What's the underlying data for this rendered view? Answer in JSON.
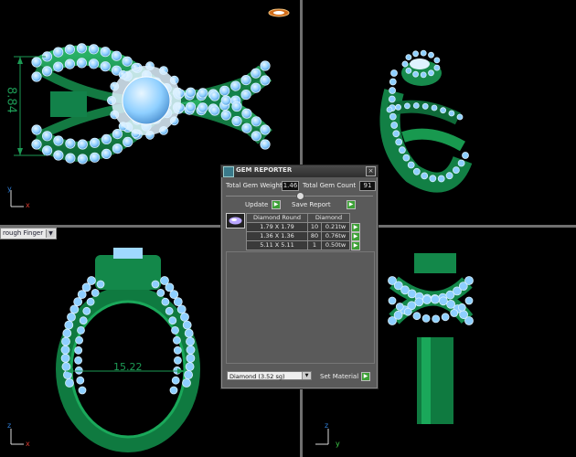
{
  "viewports": {
    "top_left": {
      "dimension_label": "8.84",
      "axis_x": "x",
      "axis_y": "y"
    },
    "top_right": {},
    "bottom_left": {
      "view_dropdown": "rough Finger",
      "dimension_label": "15.22",
      "axis_x": "x",
      "axis_z": "z"
    },
    "bottom_right": {
      "axis_y": "y",
      "axis_z": "z"
    }
  },
  "gem_reporter": {
    "title": "GEM REPORTER",
    "close_icon": "×",
    "total_weight_label": "Total Gem Weight",
    "total_weight_value": "1.46",
    "total_count_label": "Total Gem Count",
    "total_count_value": "91",
    "update_label": "Update",
    "save_report_label": "Save Report",
    "table": {
      "headers": [
        "Diamond Round",
        "Diamond"
      ],
      "rows": [
        {
          "size": "1.79 X 1.79",
          "count": "10",
          "weight": "0.21tw"
        },
        {
          "size": "1.36 X 1.36",
          "count": "80",
          "weight": "0.76tw"
        },
        {
          "size": "5.11 X 5.11",
          "count": "1",
          "weight": "0.50tw"
        }
      ]
    },
    "material_select": "Diamond   (3.52 sg)",
    "set_material_label": "Set Material"
  },
  "colors": {
    "metal": "#178a4c",
    "gem": "#8ecfff",
    "button_green": "#3da036"
  }
}
